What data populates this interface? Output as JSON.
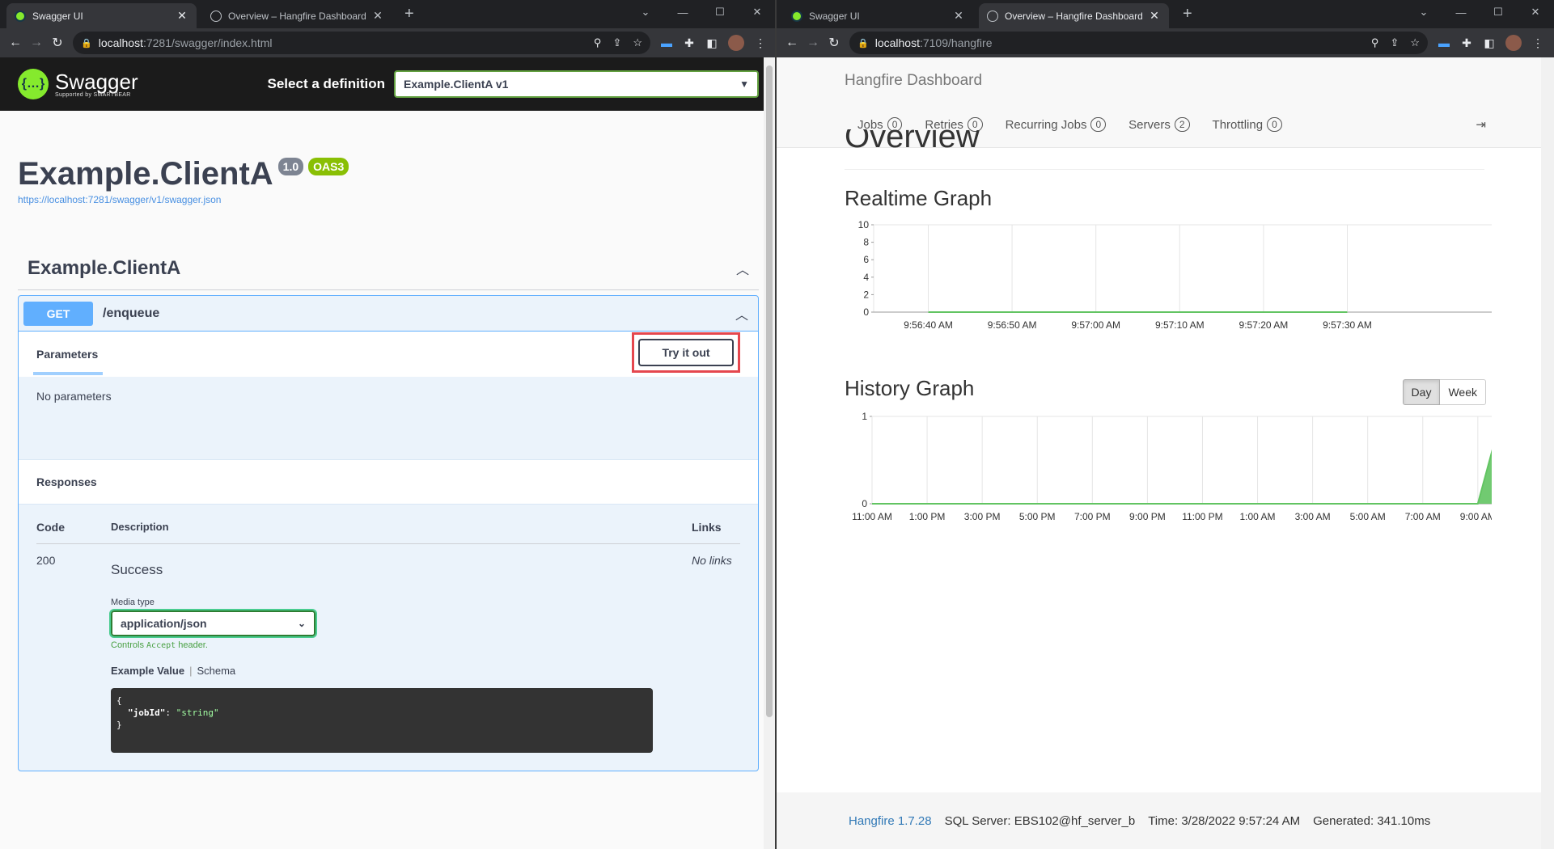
{
  "left": {
    "tabs": [
      {
        "title": "Swagger UI",
        "active": true,
        "favicon": "swagger-icon"
      },
      {
        "title": "Overview – Hangfire Dashboard",
        "active": false,
        "favicon": "globe-icon"
      }
    ],
    "url": {
      "host": "localhost",
      "path": ":7281/swagger/index.html"
    },
    "swagger": {
      "brand": "Swagger",
      "brand_sub": "Supported by SMARTBEAR",
      "select_label": "Select a definition",
      "select_value": "Example.ClientA v1",
      "title": "Example.ClientA",
      "version_badge": "1.0",
      "oas_badge": "OAS3",
      "spec_link": "https://localhost:7281/swagger/v1/swagger.json",
      "tag": "Example.ClientA",
      "operation": {
        "method": "GET",
        "path": "/enqueue",
        "params_tab": "Parameters",
        "try_button": "Try it out",
        "no_params": "No parameters",
        "responses_title": "Responses",
        "col_code": "Code",
        "col_description": "Description",
        "col_links": "Links",
        "rows": [
          {
            "code": "200",
            "description": "Success",
            "links": "No links"
          }
        ],
        "media_type_label": "Media type",
        "media_type_value": "application/json",
        "controls_prefix": "Controls",
        "controls_code": "Accept",
        "controls_suffix": "header.",
        "example_tab": "Example Value",
        "schema_tab": "Schema",
        "example_open": "{",
        "example_key": "\"jobId\"",
        "example_colon": ": ",
        "example_val": "\"string\"",
        "example_close": "}"
      }
    }
  },
  "right": {
    "tabs": [
      {
        "title": "Swagger UI",
        "active": false,
        "favicon": "swagger-icon"
      },
      {
        "title": "Overview – Hangfire Dashboard",
        "active": true,
        "favicon": "globe-icon"
      }
    ],
    "url": {
      "host": "localhost",
      "path": ":7109/hangfire"
    },
    "hangfire": {
      "brand": "Hangfire Dashboard",
      "nav": [
        {
          "label": "Jobs",
          "count": "0"
        },
        {
          "label": "Retries",
          "count": "0"
        },
        {
          "label": "Recurring Jobs",
          "count": "0"
        },
        {
          "label": "Servers",
          "count": "2"
        },
        {
          "label": "Throttling",
          "count": "0"
        }
      ],
      "page_title": "Overview",
      "realtime_title": "Realtime Graph",
      "history_title": "History Graph",
      "history_toggle": {
        "day": "Day",
        "week": "Week",
        "selected": "Day"
      },
      "footer": {
        "version": "Hangfire 1.7.28",
        "sql": "SQL Server: EBS102@hf_server_b",
        "time": "Time: 3/28/2022 9:57:24 AM",
        "generated": "Generated: 341.10ms"
      }
    }
  },
  "chart_data": [
    {
      "type": "area",
      "title": "Realtime Graph",
      "x": [
        "9:56:40 AM",
        "9:56:50 AM",
        "9:57:00 AM",
        "9:57:10 AM",
        "9:57:20 AM",
        "9:57:30 AM"
      ],
      "ylim": [
        0,
        10
      ],
      "yticks": [
        0,
        2,
        4,
        6,
        8,
        10
      ],
      "series": [
        {
          "values": [
            0,
            0,
            0,
            0,
            0,
            0
          ],
          "color": "#62c462"
        }
      ],
      "grid": true
    },
    {
      "type": "area",
      "title": "History Graph",
      "x": [
        "11:00 AM",
        "1:00 PM",
        "3:00 PM",
        "5:00 PM",
        "7:00 PM",
        "9:00 PM",
        "11:00 PM",
        "1:00 AM",
        "3:00 AM",
        "5:00 AM",
        "7:00 AM",
        "9:00 AM",
        ""
      ],
      "ylim": [
        0,
        1
      ],
      "yticks": [
        0,
        1
      ],
      "series": [
        {
          "values": [
            0,
            0,
            0,
            0,
            0,
            0,
            0,
            0,
            0,
            0,
            0,
            0,
            1
          ],
          "color": "#62c462"
        }
      ],
      "grid": true
    }
  ]
}
